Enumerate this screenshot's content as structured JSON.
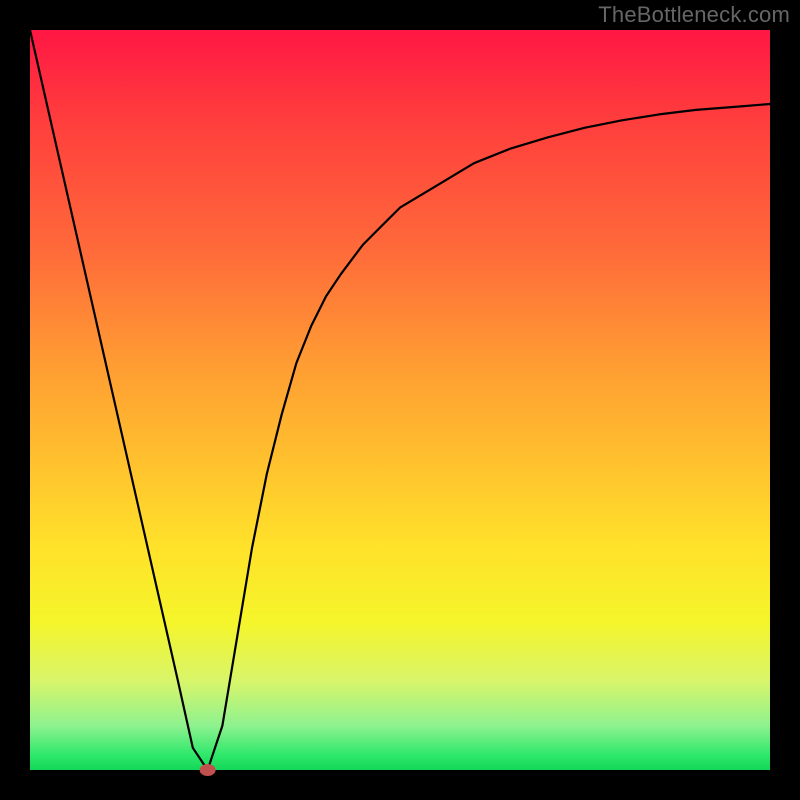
{
  "watermark": "TheBottleneck.com",
  "chart_data": {
    "type": "line",
    "title": "",
    "xlabel": "",
    "ylabel": "",
    "xlim": [
      0,
      100
    ],
    "ylim": [
      0,
      100
    ],
    "grid": false,
    "series": [
      {
        "name": "curve",
        "color": "#000000",
        "x": [
          0,
          5,
          10,
          15,
          20,
          22,
          24,
          26,
          28,
          30,
          32,
          34,
          36,
          38,
          40,
          42,
          45,
          50,
          55,
          60,
          65,
          70,
          75,
          80,
          85,
          90,
          95,
          100
        ],
        "y": [
          100,
          78,
          56,
          34,
          12,
          3,
          0,
          6,
          18,
          30,
          40,
          48,
          55,
          60,
          64,
          67,
          71,
          76,
          79,
          82,
          84,
          85.5,
          86.8,
          87.8,
          88.6,
          89.2,
          89.6,
          90
        ]
      },
      {
        "name": "marker",
        "type": "scatter",
        "color": "#c0504d",
        "x": [
          24
        ],
        "y": [
          0
        ]
      }
    ],
    "annotations": []
  },
  "colors": {
    "gradient_top": "#ff1744",
    "gradient_bottom": "#13d657",
    "curve": "#000000",
    "marker": "#c0504d",
    "frame": "#000000"
  }
}
